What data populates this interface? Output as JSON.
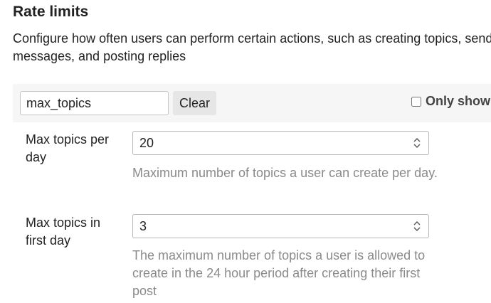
{
  "section": {
    "title": "Rate limits",
    "description": "Configure how often users can perform certain actions, such as creating topics, sending messages, and posting replies"
  },
  "filter": {
    "value": "max_topics",
    "clear_label": "Clear",
    "only_show_label": "Only show overridden"
  },
  "settings": [
    {
      "label": "Max topics per day",
      "value": "20",
      "help": "Maximum number of topics a user can create per day."
    },
    {
      "label": "Max topics in first day",
      "value": "3",
      "help": "The maximum number of topics a user is allowed to create in the 24 hour period after creating their first post"
    }
  ]
}
